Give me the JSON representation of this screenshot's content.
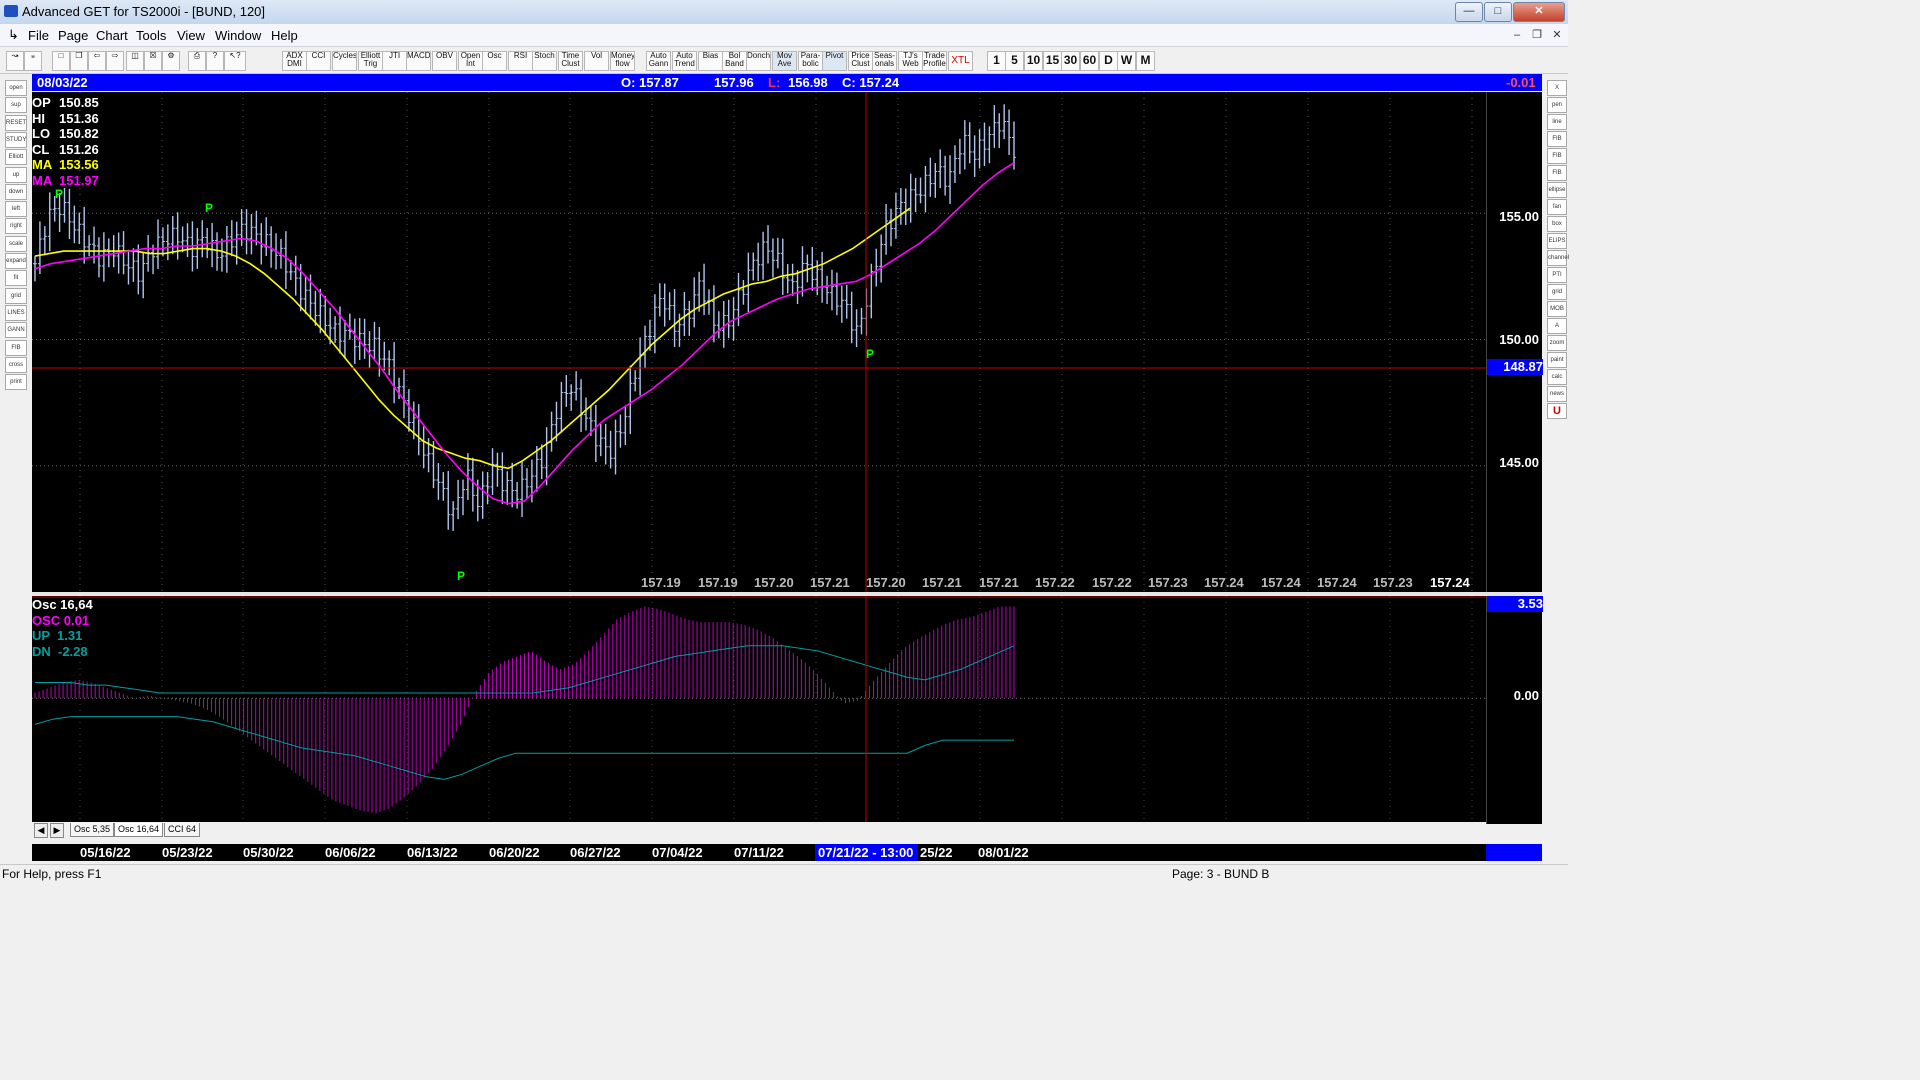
{
  "window": {
    "title": "Advanced GET for TS2000i - [BUND, 120]"
  },
  "menu": [
    "File",
    "Page",
    "Chart",
    "Tools",
    "View",
    "Window",
    "Help"
  ],
  "toolbar": {
    "studies": [
      "ADX DMI",
      "CCI",
      "Cycles",
      "Elliott Trig",
      "JTI",
      "MACD",
      "OBV",
      "Open Int",
      "Osc",
      "RSI",
      "Stoch",
      "Time Clust",
      "Vol",
      "Money flow",
      "Auto Gann",
      "Auto Trend",
      "Bias",
      "Bol Band",
      "Donch",
      "Mov Ave",
      "Para- bolic",
      "Pivot",
      "Price Clust",
      "Seas- onals",
      "TJ's Web",
      "Trade Profile",
      "XTL"
    ],
    "intervals": [
      "1",
      "5",
      "10",
      "15",
      "30",
      "60",
      "D",
      "W",
      "M"
    ]
  },
  "left_tools": [
    "open",
    "sup",
    "RESET",
    "STUDY",
    "Elliott",
    "up",
    "down",
    "left",
    "right",
    "scale",
    "expand",
    "fit",
    "grid",
    "LINES",
    "GANN",
    "FIB",
    "cross",
    "print"
  ],
  "right_tools": [
    "X",
    "pen",
    "line",
    "FIB RET",
    "FIB EXT",
    "FIB TIME",
    "ellipse",
    "fan",
    "box",
    "ELIPS",
    "channel",
    "PTI",
    "grid",
    "MOB",
    "A",
    "zoom",
    "paint",
    "calc",
    "news",
    "U"
  ],
  "info_bar": {
    "date": "08/03/22",
    "open": "O: 157.87",
    "high": "157.96",
    "low_label": "L:",
    "low": "156.98",
    "close": "C: 157.24",
    "change": "-0.01"
  },
  "price_legend": [
    {
      "label": "OP",
      "value": "150.85",
      "color": "#ffffff"
    },
    {
      "label": "HI",
      "value": "151.36",
      "color": "#ffffff"
    },
    {
      "label": "LO",
      "value": "150.82",
      "color": "#ffffff"
    },
    {
      "label": "CL",
      "value": "151.26",
      "color": "#ffffff"
    },
    {
      "label": "MA",
      "value": "153.56",
      "color": "#ffff00"
    },
    {
      "label": "MA",
      "value": "151.97",
      "color": "#ff00ff"
    }
  ],
  "price_scale": {
    "labels": [
      "155.00",
      "150.00",
      "145.00"
    ],
    "current": "148.87"
  },
  "pivots": [
    "P",
    "P",
    "P",
    "P"
  ],
  "bottom_values": [
    "157.19",
    "157.19",
    "157.20",
    "157.21",
    "157.20",
    "157.21",
    "157.21",
    "157.22",
    "157.22",
    "157.23",
    "157.24",
    "157.24",
    "157.24",
    "157.23",
    "157.24"
  ],
  "osc_legend": [
    {
      "label": "Osc 16,64",
      "color": "#ffffff"
    },
    {
      "label": "OSC 0.01",
      "color": "#ff00ff"
    },
    {
      "label": "UP  1.31",
      "color": "#00a0a0"
    },
    {
      "label": "DN  -2.28",
      "color": "#00a0a0"
    }
  ],
  "osc_scale": {
    "current": "3.53",
    "zero": "0.00"
  },
  "tabs": [
    "Osc 5,35",
    "Osc 16,64",
    "CCI 64"
  ],
  "dates": [
    "05/16/22",
    "05/23/22",
    "05/30/22",
    "06/06/22",
    "06/13/22",
    "06/20/22",
    "06/27/22",
    "07/04/22",
    "07/11/22",
    "25/22",
    "08/01/22"
  ],
  "cursor_date": "07/21/22 - 13:00",
  "status": {
    "help": "For Help, press F1",
    "page": "Page: 3 - BUND B"
  },
  "colors": {
    "info_bar": "#0000ff",
    "ma_fast": "#ffff00",
    "ma_slow": "#ff00ff",
    "bars": "#b0c4ee",
    "osc": "#c000c0",
    "bands": "#00a0a0",
    "cursor": "#c00000",
    "pivot": "#00ff00"
  },
  "chart_data": {
    "type": "candlestick",
    "price": {
      "closes": [
        153.0,
        154.9,
        155.3,
        154.5,
        153.8,
        153.2,
        153.6,
        153.0,
        152.6,
        153.6,
        154.0,
        154.1,
        153.6,
        154.0,
        153.3,
        153.9,
        154.4,
        154.1,
        153.7,
        153.2,
        152.2,
        151.5,
        150.9,
        150.3,
        150.2,
        149.9,
        149.7,
        149.1,
        147.8,
        146.6,
        145.3,
        144.2,
        143.0,
        144.7,
        143.4,
        145.0,
        144.2,
        143.9,
        144.6,
        145.4,
        147.3,
        148.2,
        147.1,
        146.1,
        145.5,
        146.6,
        148.8,
        150.3,
        151.8,
        150.5,
        151.0,
        152.3,
        150.6,
        150.6,
        151.8,
        153.0,
        153.7,
        153.0,
        152.0,
        153.0,
        152.4,
        151.8,
        151.4,
        150.2,
        152.2,
        154.2,
        155.1,
        155.6,
        156.0,
        156.7,
        156.3,
        157.9,
        157.3,
        158.0,
        158.7,
        157.5
      ],
      "ma_fast": [
        153.3,
        153.4,
        153.5,
        153.5,
        153.5,
        153.5,
        153.5,
        153.5,
        153.4,
        153.4,
        153.5,
        153.6,
        153.6,
        153.5,
        153.3,
        153.0,
        152.6,
        152.1,
        151.6,
        151.0,
        150.4,
        149.7,
        149.0,
        148.3,
        147.6,
        147.0,
        146.5,
        146.0,
        145.7,
        145.5,
        145.3,
        145.2,
        145.0,
        144.9,
        145.2,
        145.6,
        146.0,
        146.5,
        147.0,
        147.5,
        148.0,
        148.6,
        149.2,
        149.8,
        150.3,
        150.8,
        151.2,
        151.5,
        151.8,
        152.0,
        152.2,
        152.3,
        152.5,
        152.6,
        152.8,
        153.0,
        153.3,
        153.6,
        154.0,
        154.4,
        154.8,
        155.2
      ],
      "ma_slow": [
        152.8,
        153.0,
        153.1,
        153.2,
        153.3,
        153.4,
        153.5,
        153.6,
        153.6,
        153.7,
        153.7,
        153.8,
        153.9,
        154.0,
        153.9,
        153.6,
        153.2,
        152.6,
        151.9,
        151.2,
        150.4,
        149.6,
        148.8,
        147.9,
        147.1,
        146.3,
        145.5,
        144.8,
        144.2,
        143.7,
        143.5,
        143.6,
        144.2,
        144.9,
        145.6,
        146.2,
        146.8,
        147.2,
        147.6,
        148.0,
        148.5,
        149.0,
        149.6,
        150.2,
        150.7,
        151.0,
        151.3,
        151.6,
        151.8,
        152.0,
        152.1,
        152.2,
        152.3,
        152.6,
        153.0,
        153.4,
        153.8,
        154.3,
        154.9,
        155.5,
        156.1,
        156.6,
        157.0
      ],
      "ylim": [
        140.0,
        159.8
      ]
    },
    "osc": {
      "values": [
        0.2,
        0.4,
        0.6,
        0.7,
        0.6,
        0.4,
        0.2,
        0.0,
        0.1,
        0.0,
        -0.1,
        -0.2,
        -0.4,
        -0.7,
        -1.1,
        -1.5,
        -1.9,
        -2.3,
        -2.7,
        -3.1,
        -3.5,
        -3.9,
        -4.1,
        -4.3,
        -4.4,
        -4.2,
        -3.8,
        -3.3,
        -2.7,
        -1.9,
        -1.0,
        0.2,
        1.0,
        1.4,
        1.6,
        1.8,
        1.4,
        1.1,
        1.3,
        1.8,
        2.4,
        3.0,
        3.3,
        3.5,
        3.4,
        3.2,
        3.0,
        2.9,
        2.9,
        2.9,
        2.8,
        2.6,
        2.3,
        1.9,
        1.5,
        1.0,
        0.4,
        -0.2,
        -0.1,
        0.6,
        1.2,
        1.8,
        2.2,
        2.5,
        2.8,
        3.0,
        3.1,
        3.3,
        3.5,
        3.5
      ],
      "up_band": [
        0.6,
        0.6,
        0.6,
        0.5,
        0.5,
        0.4,
        0.3,
        0.2,
        0.2,
        0.2,
        0.2,
        0.2,
        0.2,
        0.2,
        0.2,
        0.2,
        0.2,
        0.2,
        0.2,
        0.2,
        0.2,
        0.2,
        0.2,
        0.2,
        0.2,
        0.2,
        0.2,
        0.2,
        0.2,
        0.3,
        0.4,
        0.6,
        0.8,
        1.0,
        1.2,
        1.4,
        1.6,
        1.7,
        1.8,
        1.9,
        2.0,
        2.0,
        2.0,
        1.9,
        1.8,
        1.6,
        1.4,
        1.2,
        1.0,
        0.8,
        0.7,
        0.9,
        1.1,
        1.4,
        1.7,
        2.0
      ],
      "dn_band": [
        -1.0,
        -0.8,
        -0.7,
        -0.7,
        -0.7,
        -0.7,
        -0.7,
        -0.7,
        -0.7,
        -0.8,
        -0.9,
        -1.1,
        -1.3,
        -1.5,
        -1.7,
        -1.9,
        -2.0,
        -2.1,
        -2.2,
        -2.4,
        -2.6,
        -2.8,
        -3.0,
        -3.1,
        -2.9,
        -2.6,
        -2.3,
        -2.1,
        -2.1,
        -2.1,
        -2.1,
        -2.1,
        -2.1,
        -2.1,
        -2.1,
        -2.1,
        -2.1,
        -2.1,
        -2.1,
        -2.1,
        -2.1,
        -2.1,
        -2.1,
        -2.1,
        -2.1,
        -2.1,
        -2.1,
        -2.1,
        -2.1,
        -2.1,
        -1.8,
        -1.6,
        -1.6,
        -1.6,
        -1.6,
        -1.6
      ],
      "ylim": [
        -4.8,
        3.9
      ]
    }
  }
}
